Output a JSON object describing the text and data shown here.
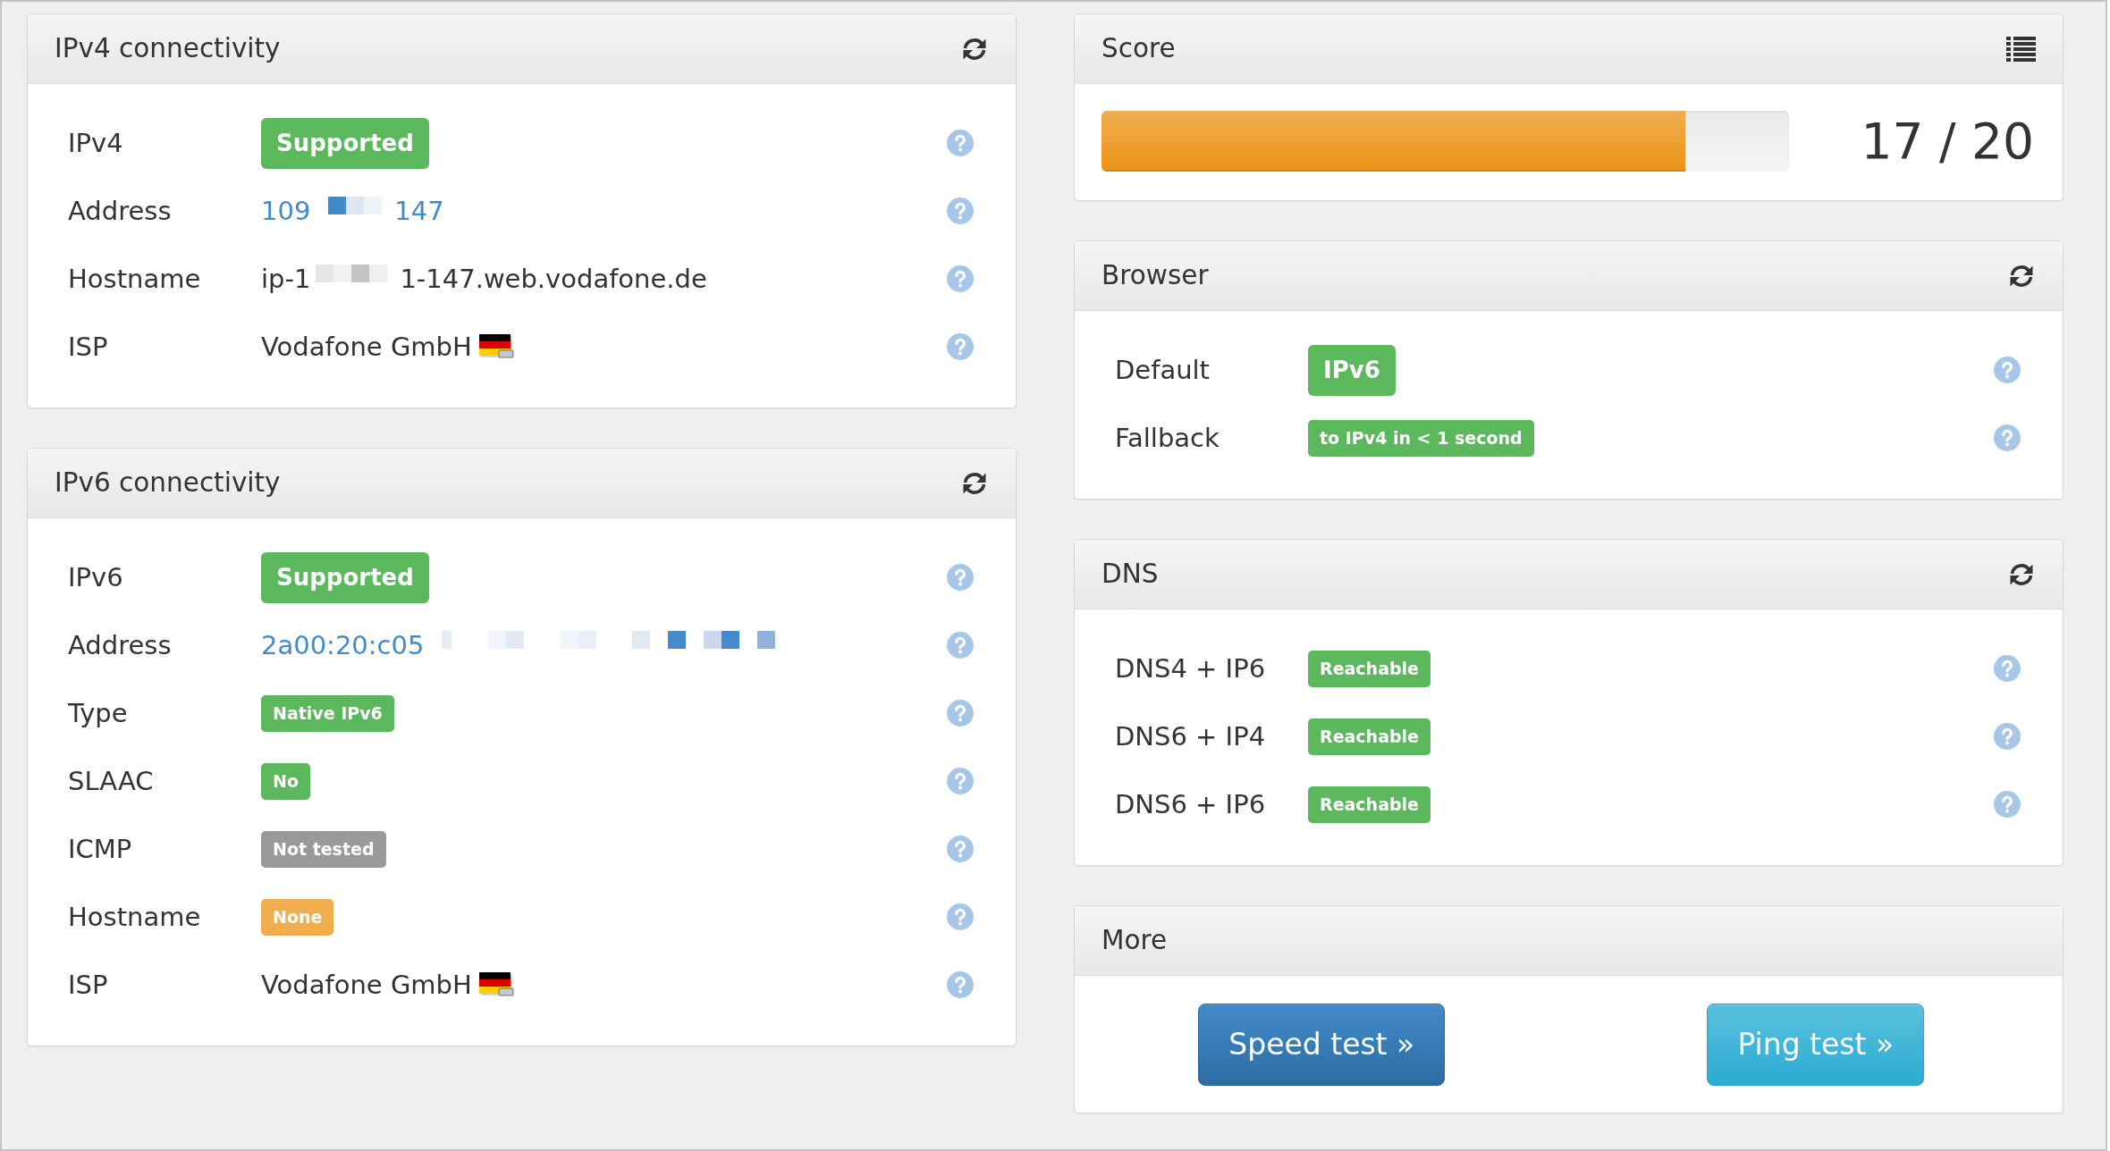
{
  "left_column": [
    {
      "title": "IPv4 connectivity",
      "kind": "details",
      "rows": [
        {
          "label": "IPv4",
          "kind": "badge",
          "value": "Supported",
          "color": "#5cb85c"
        },
        {
          "label": "Address",
          "kind": "link",
          "value": "109",
          "redacted": true,
          "value_end": "147"
        },
        {
          "label": "Hostname",
          "kind": "text",
          "value": "ip-1",
          "redacted": true,
          "value_end": "1-147.web.vodafone.de"
        },
        {
          "label": "ISP",
          "kind": "isp",
          "value": "Vodafone GmbH"
        }
      ]
    },
    {
      "title": "IPv6 connectivity",
      "kind": "details",
      "rows": [
        {
          "label": "IPv6",
          "kind": "badge",
          "value": "Supported",
          "color": "#5cb85c"
        },
        {
          "label": "Address",
          "kind": "link",
          "value": "2a00:20:c05",
          "redacted": true
        },
        {
          "label": "Type",
          "kind": "tag",
          "value": "Native IPv6",
          "color": "#5cb85c"
        },
        {
          "label": "SLAAC",
          "kind": "tag",
          "value": "No",
          "color": "#5cb85c"
        },
        {
          "label": "ICMP",
          "kind": "tag",
          "value": "Not tested",
          "color": "#999999"
        },
        {
          "label": "Hostname",
          "kind": "tag",
          "value": "None",
          "color": "#f0ad4e"
        },
        {
          "label": "ISP",
          "kind": "isp",
          "value": "Vodafone GmbH"
        }
      ]
    }
  ],
  "right_column": [
    {
      "title": "Score",
      "kind": "score",
      "level": 0.85,
      "reading": "17 / 20"
    },
    {
      "title": "Browser",
      "kind": "details",
      "rows": [
        {
          "label": "Default",
          "kind": "badge",
          "value": "IPv6",
          "color": "#5cb85c"
        },
        {
          "label": "Fallback",
          "kind": "tag",
          "value": "to IPv4 in < 1 second",
          "color": "#5cb85c"
        }
      ]
    },
    {
      "title": "DNS",
      "kind": "details",
      "rows": [
        {
          "label": "DNS4 + IP6",
          "kind": "tag",
          "value": "Reachable",
          "color": "#5cb85c"
        },
        {
          "label": "DNS6 + IP4",
          "kind": "tag",
          "value": "Reachable",
          "color": "#5cb85c"
        },
        {
          "label": "DNS6 + IP6",
          "kind": "tag",
          "value": "Reachable",
          "color": "#5cb85c"
        }
      ]
    },
    {
      "title": "More",
      "kind": "links",
      "buttons": [
        {
          "label": "Speed test »"
        },
        {
          "label": "Ping test »"
        }
      ]
    }
  ]
}
